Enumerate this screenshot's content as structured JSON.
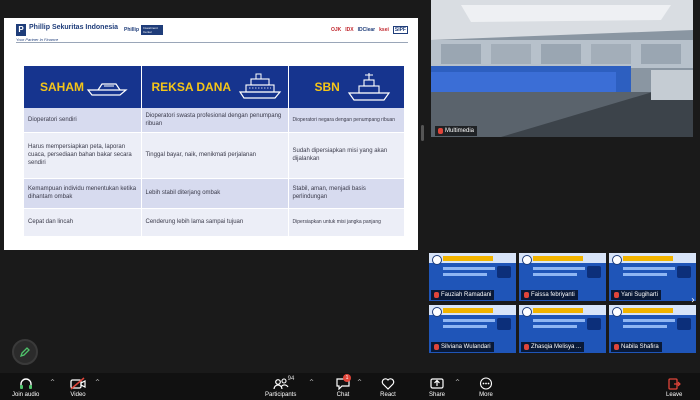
{
  "slide": {
    "brand": {
      "name": "Phillip Sekuritas Indonesia",
      "tagline": "Your Partner In Finance",
      "pill_main": "Phillip",
      "pill_sub": "Investment Center"
    },
    "partners": [
      "OJK",
      "IDX",
      "IDClear",
      "ksei",
      "SIPF"
    ],
    "table": {
      "headers": [
        "SAHAM",
        "REKSA DANA",
        "SBN"
      ],
      "rows": [
        [
          "Dioperatori sendiri",
          "Dioperatori swasta profesional dengan penumpang ribuan",
          "Dioperatori negara dengan penumpang ribuan"
        ],
        [
          "Harus mempersiapkan peta, laporan cuaca, persediaan bahan bakar secara sendiri",
          "Tinggal bayar, naik, menikmati perjalanan",
          "Sudah dipersiapkan misi yang akan dijalankan"
        ],
        [
          "Kemampuan individu menentukan ketika dihantam ombak",
          "Lebih stabil diterjang ombak",
          "Stabil, aman, menjadi basis perlindungan"
        ],
        [
          "Cepat dan lincah",
          "Cenderung lebih lama sampai tujuan",
          "Dipersiapkan untuk misi jangka panjang"
        ]
      ]
    }
  },
  "video": {
    "label": "Multimedia"
  },
  "gallery": [
    {
      "name": "Fauziah Ramadani"
    },
    {
      "name": "Faissa febriyanti"
    },
    {
      "name": "Yani Sugiharti"
    },
    {
      "name": "Silviana Wulandari"
    },
    {
      "name": "Zhasqia Melisya ..."
    },
    {
      "name": "Nabila Shafira"
    }
  ],
  "toolbar": {
    "join_audio": "Join audio",
    "video": "Video",
    "participants": "Participants",
    "participants_count": "94",
    "chat": "Chat",
    "chat_badge": "1",
    "react": "React",
    "share": "Share",
    "more": "More",
    "leave": "Leave"
  },
  "colors": {
    "accent": "#16348e",
    "header_text": "#f5c518",
    "leave": "#e0453a"
  },
  "icons": [
    "headphones-icon",
    "video-off-icon",
    "participants-icon",
    "chat-icon",
    "heart-icon",
    "share-icon",
    "more-icon",
    "leave-icon",
    "pencil-icon",
    "mic-off-icon"
  ]
}
